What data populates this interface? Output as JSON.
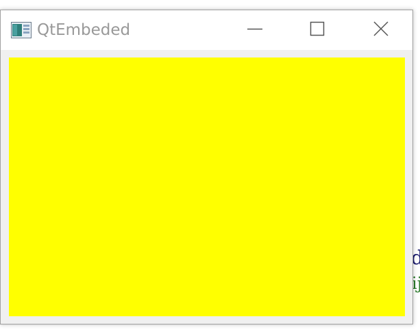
{
  "window": {
    "title": "QtEmbeded",
    "client_color": "#ffff00",
    "frame_color": "#f0f0f0",
    "titlebar_color": "#ffffff",
    "title_color": "#999999"
  },
  "icons": {
    "app": "app-icon",
    "minimize": "minimize-icon",
    "maximize": "maximize-icon",
    "close": "close-icon"
  },
  "background_editor_fragments": {
    "glyph_1": "d",
    "glyph_2": "ij"
  }
}
